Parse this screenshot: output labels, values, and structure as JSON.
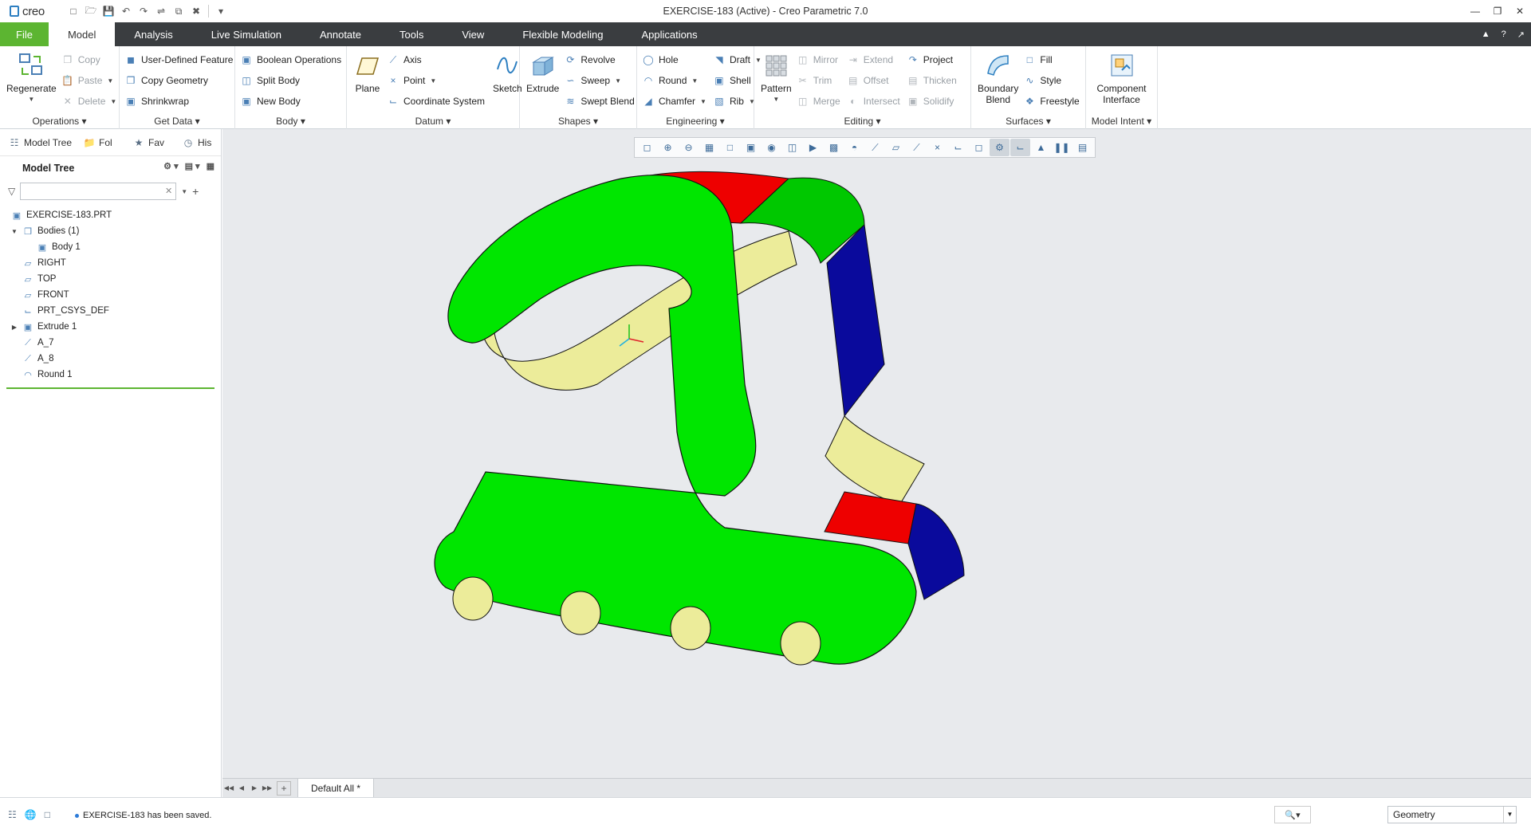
{
  "app": {
    "logo": "creo",
    "window_title": "EXERCISE-183 (Active) - Creo Parametric 7.0"
  },
  "tabs": [
    "File",
    "Model",
    "Analysis",
    "Live Simulation",
    "Annotate",
    "Tools",
    "View",
    "Flexible Modeling",
    "Applications"
  ],
  "active_tab": "Model",
  "ribbon": {
    "operations": {
      "title": "Operations",
      "regenerate": "Regenerate",
      "copy": "Copy",
      "paste": "Paste",
      "delete": "Delete"
    },
    "get_data": {
      "title": "Get Data",
      "udf": "User-Defined Feature",
      "copy_geometry": "Copy Geometry",
      "shrinkwrap": "Shrinkwrap"
    },
    "body": {
      "title": "Body",
      "boolean": "Boolean Operations",
      "split": "Split Body",
      "new": "New Body"
    },
    "datum": {
      "title": "Datum",
      "plane": "Plane",
      "axis": "Axis",
      "point": "Point",
      "csys": "Coordinate System",
      "sketch": "Sketch"
    },
    "shapes": {
      "title": "Shapes",
      "extrude": "Extrude",
      "revolve": "Revolve",
      "sweep": "Sweep",
      "swept_blend": "Swept Blend"
    },
    "engineering": {
      "title": "Engineering",
      "hole": "Hole",
      "round": "Round",
      "chamfer": "Chamfer",
      "draft": "Draft",
      "shell": "Shell",
      "rib": "Rib"
    },
    "editing": {
      "title": "Editing",
      "pattern": "Pattern",
      "mirror": "Mirror",
      "trim": "Trim",
      "merge": "Merge",
      "extend": "Extend",
      "offset": "Offset",
      "intersect": "Intersect",
      "project": "Project",
      "thicken": "Thicken",
      "solidify": "Solidify"
    },
    "surfaces": {
      "title": "Surfaces",
      "boundary_blend_1": "Boundary",
      "boundary_blend_2": "Blend",
      "fill": "Fill",
      "style": "Style",
      "freestyle": "Freestyle"
    },
    "model_intent": {
      "title": "Model Intent",
      "component_1": "Component",
      "component_2": "Interface"
    }
  },
  "navigator": {
    "tabs": [
      "Model Tree",
      "Fol",
      "Fav",
      "His"
    ],
    "tree_title": "Model Tree",
    "filter_placeholder": "",
    "nodes": [
      {
        "label": "EXERCISE-183.PRT",
        "icon": "part-icon",
        "indent": 0,
        "expander": ""
      },
      {
        "label": "Bodies (1)",
        "icon": "bodies-icon",
        "indent": 1,
        "expander": "expanded"
      },
      {
        "label": "Body 1",
        "icon": "body-icon",
        "indent": 2,
        "expander": ""
      },
      {
        "label": "RIGHT",
        "icon": "datum-plane-icon",
        "indent": 1,
        "expander": ""
      },
      {
        "label": "TOP",
        "icon": "datum-plane-icon",
        "indent": 1,
        "expander": ""
      },
      {
        "label": "FRONT",
        "icon": "datum-plane-icon",
        "indent": 1,
        "expander": ""
      },
      {
        "label": "PRT_CSYS_DEF",
        "icon": "csys-icon",
        "indent": 1,
        "expander": ""
      },
      {
        "label": "Extrude 1",
        "icon": "extrude-icon",
        "indent": 1,
        "expander": "collapsed"
      },
      {
        "label": "A_7",
        "icon": "axis-icon",
        "indent": 1,
        "expander": ""
      },
      {
        "label": "A_8",
        "icon": "axis-icon",
        "indent": 1,
        "expander": ""
      },
      {
        "label": "Round 1",
        "icon": "round-icon",
        "indent": 1,
        "expander": ""
      }
    ]
  },
  "graphics": {
    "view_toolbar_icons": [
      "refit-icon",
      "zoom-in-icon",
      "zoom-out-icon",
      "repaint-icon",
      "view-manager-icon",
      "display-style-icon",
      "saved-orientations-icon",
      "named-views-icon",
      "section-icon",
      "perspective-icon",
      "appearance-icon",
      "datum-display-icon",
      "plane-display-icon",
      "axis-display-icon",
      "point-display-icon",
      "csys-display-icon",
      "annotation-display-icon",
      "spin-center-icon",
      "csys-toggle-icon",
      "display-3d-icon",
      "pause-icon",
      "animation-icon"
    ],
    "colors": {
      "face_green": "#00e600",
      "face_red": "#ee0000",
      "face_blue": "#0a0a9c",
      "face_yellow": "#ecec9a",
      "background": "#e8eaed"
    }
  },
  "bottom_tabs": {
    "active": "Default All *"
  },
  "status": {
    "message": "EXERCISE-183 has been saved.",
    "filter_value": "Geometry"
  }
}
